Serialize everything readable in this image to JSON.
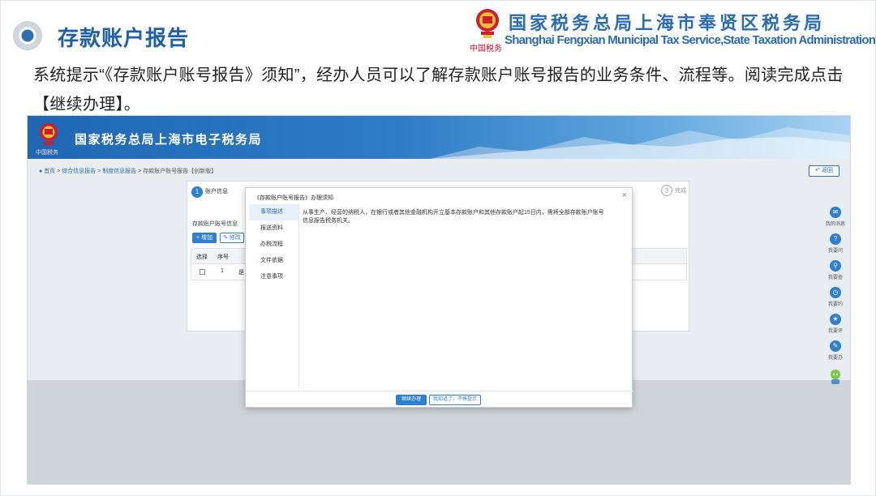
{
  "slide": {
    "title": "存款账户报告",
    "brand_cn": "国家税务总局上海市奉贤区税务局",
    "brand_en": "Shanghai Fengxian Municipal Tax Service,State Taxation Administration",
    "emblem_caption": "中国税务",
    "description": "系统提示“《存款账户账号报告》须知”，经办人员可以了解存款账户账号报告的业务条件、流程等。阅读完成点击【继续办理】。"
  },
  "screen": {
    "banner_title": "国家税务总局上海市电子税务局",
    "banner_emblem_caption": "中国税务",
    "breadcrumb": {
      "home": "首页",
      "sep": ">",
      "item1": "综合信息报告",
      "item2": "制度信息报告",
      "item3": "存款账户账号报告【创新版】"
    },
    "back_label": "返回",
    "steps": {
      "step1_num": "1",
      "step1_label": "账户信息",
      "step3_num": "3",
      "step3_label": "完成"
    },
    "section_label": "存款账户账号信息",
    "add_button": "+ 增加",
    "edit_button": "修改",
    "table": {
      "headers": [
        "选择",
        "序号"
      ],
      "row1": {
        "index": "1",
        "partial": "是"
      }
    },
    "right_rail": [
      {
        "label": "我的消息",
        "icon": "message-icon"
      },
      {
        "label": "我要问",
        "icon": "question-icon"
      },
      {
        "label": "我要查",
        "icon": "search-icon"
      },
      {
        "label": "我要约",
        "icon": "appointment-icon"
      },
      {
        "label": "我要评",
        "icon": "rating-icon"
      },
      {
        "label": "我要办",
        "icon": "handle-icon"
      }
    ],
    "modal": {
      "title": "《存款账户账号报告》办理须知",
      "tabs": [
        "事项描述",
        "报送资料",
        "办税流程",
        "文件依据",
        "注意事项"
      ],
      "active_tab": 0,
      "body": "从事生产、经营的纳税人，在银行或者其他金融机构开立基本存款账户和其他存款账户起15日内，需将全部存款账户账号信息报告税务机关。",
      "primary_button": "继续办理",
      "secondary_button": "我知道了，不再提示"
    }
  },
  "colors": {
    "title_blue": "#1f5fa8",
    "brand_blue": "#2a6bb3",
    "accent_blue": "#2d7fd1",
    "emblem_red": "#c8102e"
  }
}
